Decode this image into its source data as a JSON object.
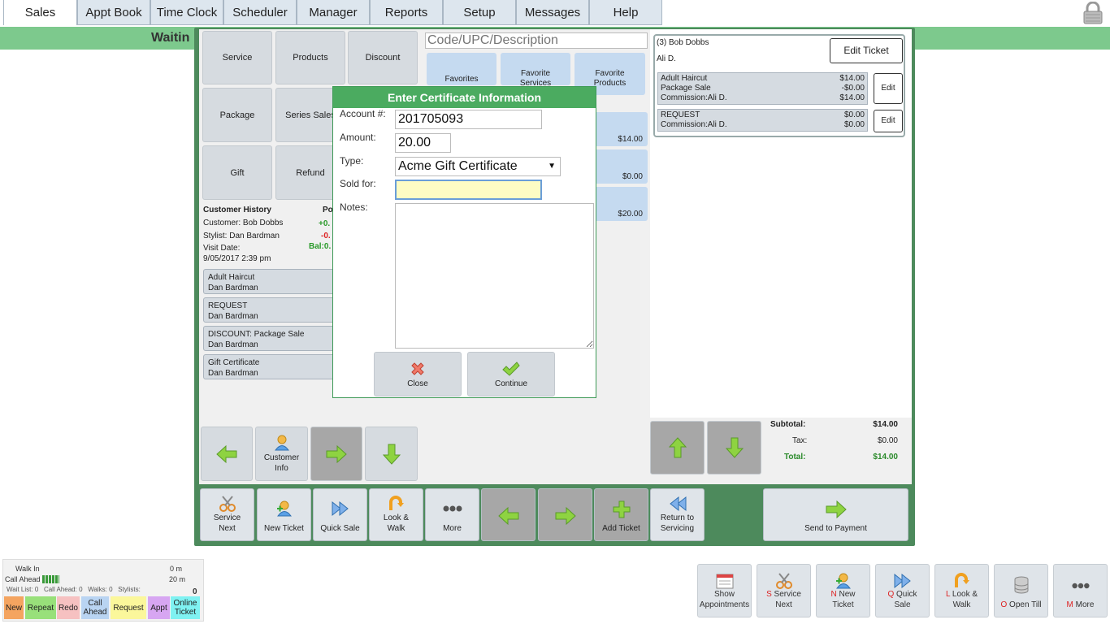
{
  "tabs": [
    "Sales",
    "Appt Book",
    "Time Clock",
    "Scheduler",
    "Manager",
    "Reports",
    "Setup",
    "Messages",
    "Help"
  ],
  "waiting_text": "Waitin",
  "left_buttons": [
    "Service",
    "Products",
    "Discount",
    "Package",
    "Series Sales",
    "Gift",
    "Refund"
  ],
  "customer_history": {
    "title": "Customer History",
    "points_label": "Po",
    "customer": "Customer: Bob Dobbs",
    "stylist": "Stylist: Dan Bardman",
    "visit_label": "Visit Date:",
    "visit_date": "9/05/2017 2:39 pm",
    "plus_val": "+0.",
    "minus_val": "-0.",
    "bal": "Bal:0.",
    "items": [
      {
        "name": "Adult Haircut",
        "stylist": "Dan Bardman"
      },
      {
        "name": "REQUEST",
        "stylist": "Dan Bardman"
      },
      {
        "name": "DISCOUNT: Package Sale",
        "stylist": "Dan Bardman"
      },
      {
        "name": "Gift Certificate",
        "stylist": "Dan Bardman"
      }
    ]
  },
  "left_nav": {
    "customer_info": "Customer\nInfo"
  },
  "search": {
    "placeholder": "Code/UPC/Description"
  },
  "favorites": [
    "Favorites",
    "Favorite\nServices",
    "Favorite\nProducts"
  ],
  "mid_prices": [
    "$14.00",
    "$0.00",
    "$20.00"
  ],
  "ticket": {
    "title": "(3) Bob Dobbs",
    "stylist": "Ali D.",
    "edit_ticket": "Edit Ticket",
    "line1": {
      "name": "Adult Haircut",
      "price": "$14.00",
      "sub": "Package Sale",
      "sub_price": "-$0.00",
      "commission": "Commission:Ali D.",
      "commission_price": "$14.00"
    },
    "line2": {
      "name": "REQUEST",
      "price": "$0.00",
      "commission": "Commission:Ali D.",
      "commission_price": "$0.00"
    },
    "edit_label": "Edit"
  },
  "totals": {
    "subtotal_label": "Subtotal:",
    "subtotal": "$14.00",
    "tax_label": "Tax:",
    "tax": "$0.00",
    "total_label": "Total:",
    "total": "$14.00"
  },
  "dialog": {
    "title": "Enter Certificate Information",
    "account_label": "Account #:",
    "account_value": "201705093",
    "amount_label": "Amount:",
    "amount_value": "20.00",
    "type_label": "Type:",
    "type_value": "Acme Gift Certificate",
    "sold_for_label": "Sold for:",
    "sold_for_value": "",
    "notes_label": "Notes:",
    "close": "Close",
    "continue": "Continue"
  },
  "actions": {
    "service_next": "Service\nNext",
    "new_ticket": "New Ticket",
    "quick_sale": "Quick Sale",
    "look_walk": "Look &\nWalk",
    "more": "More",
    "add_ticket": "Add Ticket",
    "return_servicing": "Return to\nServicing",
    "send_payment": "Send to Payment"
  },
  "status": {
    "walk_in": "Walk In",
    "walk_in_val": "0 m",
    "call_ahead": "Call Ahead",
    "call_ahead_val": "20 m",
    "counts": "Wait List: 0   Call Ahead: 0   Walks: 0   Stylists:",
    "stylists_count": "0"
  },
  "legend": [
    {
      "label": "New",
      "color": "#f4a460"
    },
    {
      "label": "Repeat",
      "color": "#98e07a"
    },
    {
      "label": "Redo",
      "color": "#f6c1c1"
    },
    {
      "label": "Call\nAhead",
      "color": "#b9d4f2"
    },
    {
      "label": "Request",
      "color": "#fbf79b"
    },
    {
      "label": "Appt",
      "color": "#d7a6f2"
    },
    {
      "label": "Online\nTicket",
      "color": "#7ff2f2"
    }
  ],
  "bottom_bar": [
    {
      "key": "",
      "label": "Show\nAppointments"
    },
    {
      "key": "S",
      "label": "Service\nNext"
    },
    {
      "key": "N",
      "label": "New\nTicket"
    },
    {
      "key": "Q",
      "label": "Quick\nSale"
    },
    {
      "key": "L",
      "label": "Look &\nWalk"
    },
    {
      "key": "O",
      "label": "Open Till"
    },
    {
      "key": "M",
      "label": "More"
    }
  ]
}
